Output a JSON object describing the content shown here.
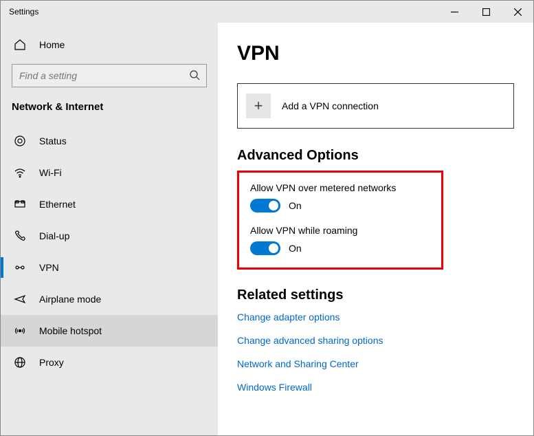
{
  "window": {
    "title": "Settings"
  },
  "sidebar": {
    "home": "Home",
    "search_placeholder": "Find a setting",
    "section": "Network & Internet",
    "items": [
      {
        "label": "Status"
      },
      {
        "label": "Wi-Fi"
      },
      {
        "label": "Ethernet"
      },
      {
        "label": "Dial-up"
      },
      {
        "label": "VPN"
      },
      {
        "label": "Airplane mode"
      },
      {
        "label": "Mobile hotspot"
      },
      {
        "label": "Proxy"
      }
    ]
  },
  "main": {
    "heading": "VPN",
    "add_connection": "Add a VPN connection",
    "advanced_heading": "Advanced Options",
    "opt1_label": "Allow VPN over metered networks",
    "opt1_state": "On",
    "opt2_label": "Allow VPN while roaming",
    "opt2_state": "On",
    "related_heading": "Related settings",
    "links": [
      "Change adapter options",
      "Change advanced sharing options",
      "Network and Sharing Center",
      "Windows Firewall"
    ]
  }
}
